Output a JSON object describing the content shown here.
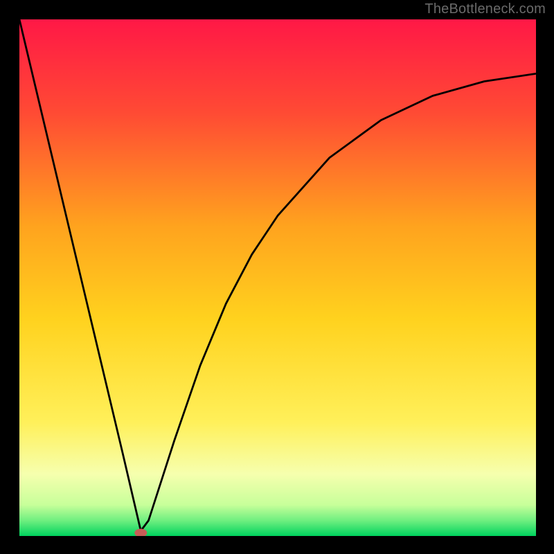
{
  "watermark": "TheBottleneck.com",
  "chart_data": {
    "type": "line",
    "title": "",
    "xlabel": "",
    "ylabel": "",
    "xlim": [
      0,
      1
    ],
    "ylim": [
      0,
      1
    ],
    "grid": false,
    "legend": false,
    "background_gradient": [
      "#ff1846",
      "#ff6a2d",
      "#ffc81e",
      "#fff664",
      "#f5ffb6",
      "#9cff94",
      "#00d35e"
    ],
    "series": [
      {
        "name": "bottleneck-curve",
        "x": [
          0.0,
          0.05,
          0.1,
          0.15,
          0.2,
          0.235,
          0.25,
          0.27,
          0.3,
          0.35,
          0.4,
          0.45,
          0.5,
          0.6,
          0.7,
          0.8,
          0.9,
          1.0
        ],
        "y": [
          1.0,
          0.79,
          0.58,
          0.37,
          0.16,
          0.01,
          0.03,
          0.092,
          0.185,
          0.33,
          0.45,
          0.545,
          0.62,
          0.732,
          0.805,
          0.852,
          0.88,
          0.895
        ]
      }
    ],
    "annotations": [
      {
        "name": "minimum-marker",
        "x": 0.235,
        "y": 0.006,
        "shape": "ellipse",
        "color": "#c65d57"
      }
    ]
  }
}
